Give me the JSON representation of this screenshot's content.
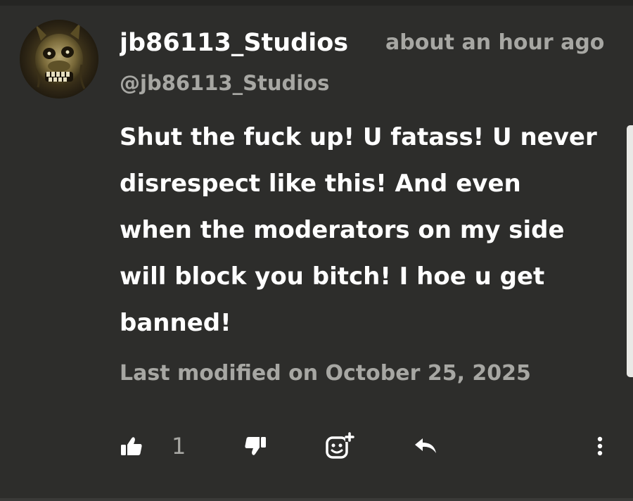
{
  "comment": {
    "author_name": "jb86113_Studios",
    "author_handle": "@jb86113_Studios",
    "time_ago": "about an hour ago",
    "body": "Shut the fuck up! U fatass! U never disrespect like this! And even when the moderators on my side will block you bitch! I hoe u get banned!",
    "modified": "Last modified on October 25, 2025",
    "like_count": "1"
  },
  "actions": {
    "like_icon": "thumbs-up-icon",
    "dislike_icon": "thumbs-down-icon",
    "react_icon": "add-reaction-icon",
    "reply_icon": "reply-icon",
    "more_icon": "more-vertical-icon"
  },
  "colors": {
    "background": "#2d2d2b",
    "primary_text": "#ffffff",
    "secondary_text": "#a7a7a3"
  }
}
